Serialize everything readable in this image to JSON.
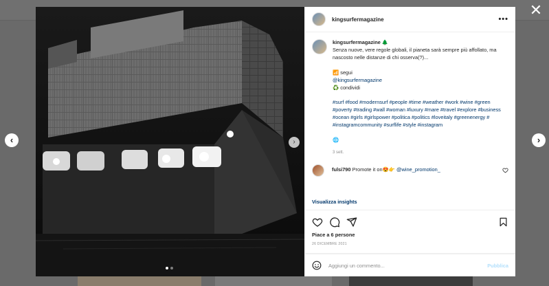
{
  "post": {
    "username": "kingsurfermagazine",
    "more_label": "•••",
    "caption": {
      "username": "kingsurfermagazine",
      "emoji": "🌲",
      "text": "Senza nuove, vere regole globali, il pianeta sarà sempre più affollato, ma nascosto nelle distanze di chi osserva(?)...",
      "follow_line": "📶 segui",
      "mention": "@kingsurfermagazine",
      "share_line": "♻️ condividi",
      "hashtags": "#surf #food #modernsurf #people #time #weather #work #wine #green #poverty #trading #wall #woman #luxury #mare #travel #explore #business #ocean #girls #girlspower #politica #politics #loveitaly #greenenergy # #instagramcommunity #surflife #style #instagram",
      "globe": "🌐",
      "time_ago": "3 sett."
    },
    "comment": {
      "username": "fulsi790",
      "text": "Promote it on😍👉",
      "mention": "@wine_promotion_"
    },
    "insights_label": "Visualizza insights",
    "likes": "Piace a 6 persone",
    "date": "26 DICEMBRE 2021",
    "comment_placeholder": "Aggiungi un commento...",
    "publish_label": "Pubblica"
  },
  "icons": {
    "close": "close-icon",
    "prev": "chevron-left-icon",
    "next": "chevron-right-icon",
    "like": "heart-icon",
    "comment": "comment-icon",
    "share": "paper-plane-icon",
    "save": "bookmark-icon",
    "emoji": "smiley-icon"
  },
  "carousel": {
    "total": 2,
    "current": 1
  }
}
